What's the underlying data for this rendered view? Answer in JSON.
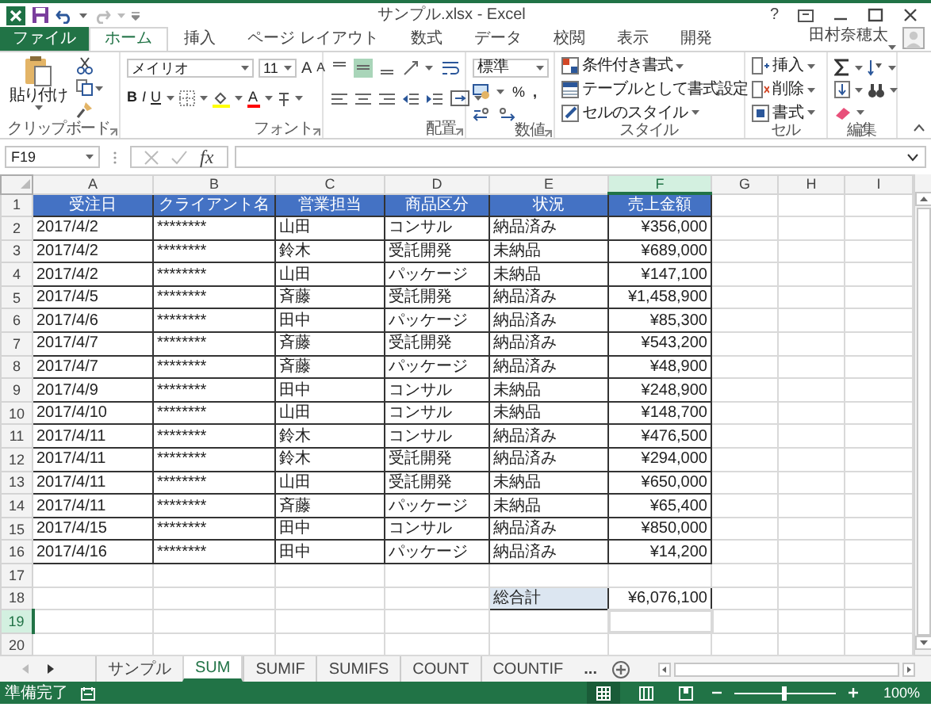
{
  "title_bar": {
    "title": "サンプル.xlsx - Excel",
    "help": "?"
  },
  "ribbon_tabs": [
    {
      "label": "ファイル",
      "kind": "file",
      "selected": false
    },
    {
      "label": "ホーム",
      "kind": "tab",
      "selected": true
    },
    {
      "label": "挿入",
      "kind": "tab",
      "selected": false
    },
    {
      "label": "ページ レイアウト",
      "kind": "tab",
      "selected": false
    },
    {
      "label": "数式",
      "kind": "tab",
      "selected": false
    },
    {
      "label": "データ",
      "kind": "tab",
      "selected": false
    },
    {
      "label": "校閲",
      "kind": "tab",
      "selected": false
    },
    {
      "label": "表示",
      "kind": "tab",
      "selected": false
    },
    {
      "label": "開発",
      "kind": "tab",
      "selected": false
    }
  ],
  "user": "田村奈穂太",
  "ribbon": {
    "clipboard": {
      "paste": "貼り付け",
      "label": "クリップボード"
    },
    "font": {
      "name": "メイリオ",
      "size": "11",
      "grow": "A",
      "shrink": "A",
      "bold": "B",
      "italic": "I",
      "underline": "U",
      "font_color": "A",
      "label": "フォント"
    },
    "alignment": {
      "label": "配置"
    },
    "number": {
      "format": "標準",
      "percent": "%",
      "comma": ",",
      "label": "数値"
    },
    "styles": {
      "items": [
        "条件付き書式",
        "テーブルとして書式設定",
        "セルのスタイル"
      ],
      "label": "スタイル"
    },
    "cells": {
      "items": [
        "挿入",
        "削除",
        "書式"
      ],
      "label": "セル"
    },
    "editing": {
      "label": "編集"
    }
  },
  "formula_bar": {
    "name_box": "F19",
    "fx": "fx"
  },
  "columns": [
    {
      "label": "A",
      "selected": false
    },
    {
      "label": "B",
      "selected": false
    },
    {
      "label": "C",
      "selected": false
    },
    {
      "label": "D",
      "selected": false
    },
    {
      "label": "E",
      "selected": false
    },
    {
      "label": "F",
      "selected": true
    },
    {
      "label": "G",
      "selected": false
    },
    {
      "label": "H",
      "selected": false
    },
    {
      "label": "I",
      "selected": false
    }
  ],
  "rows": [
    {
      "number": "1",
      "kind": "header",
      "selected": false,
      "cells": {
        "A": "受注日",
        "B": "クライアント名",
        "C": "営業担当",
        "D": "商品区分",
        "E": "状況",
        "F": "売上金額"
      }
    },
    {
      "number": "2",
      "kind": "data",
      "selected": false,
      "cells": {
        "A": "2017/4/2",
        "B": "********",
        "C": "山田",
        "D": "コンサル",
        "E": "納品済み",
        "F": "¥356,000"
      }
    },
    {
      "number": "3",
      "kind": "data",
      "selected": false,
      "cells": {
        "A": "2017/4/2",
        "B": "********",
        "C": "鈴木",
        "D": "受託開発",
        "E": "未納品",
        "F": "¥689,000"
      }
    },
    {
      "number": "4",
      "kind": "data",
      "selected": false,
      "cells": {
        "A": "2017/4/2",
        "B": "********",
        "C": "山田",
        "D": "パッケージ",
        "E": "未納品",
        "F": "¥147,100"
      }
    },
    {
      "number": "5",
      "kind": "data",
      "selected": false,
      "cells": {
        "A": "2017/4/5",
        "B": "********",
        "C": "斉藤",
        "D": "受託開発",
        "E": "納品済み",
        "F": "¥1,458,900"
      }
    },
    {
      "number": "6",
      "kind": "data",
      "selected": false,
      "cells": {
        "A": "2017/4/6",
        "B": "********",
        "C": "田中",
        "D": "パッケージ",
        "E": "納品済み",
        "F": "¥85,300"
      }
    },
    {
      "number": "7",
      "kind": "data",
      "selected": false,
      "cells": {
        "A": "2017/4/7",
        "B": "********",
        "C": "斉藤",
        "D": "受託開発",
        "E": "納品済み",
        "F": "¥543,200"
      }
    },
    {
      "number": "8",
      "kind": "data",
      "selected": false,
      "cells": {
        "A": "2017/4/7",
        "B": "********",
        "C": "斉藤",
        "D": "パッケージ",
        "E": "納品済み",
        "F": "¥48,900"
      }
    },
    {
      "number": "9",
      "kind": "data",
      "selected": false,
      "cells": {
        "A": "2017/4/9",
        "B": "********",
        "C": "田中",
        "D": "コンサル",
        "E": "未納品",
        "F": "¥248,900"
      }
    },
    {
      "number": "10",
      "kind": "data",
      "selected": false,
      "cells": {
        "A": "2017/4/10",
        "B": "********",
        "C": "山田",
        "D": "コンサル",
        "E": "未納品",
        "F": "¥148,700"
      }
    },
    {
      "number": "11",
      "kind": "data",
      "selected": false,
      "cells": {
        "A": "2017/4/11",
        "B": "********",
        "C": "鈴木",
        "D": "コンサル",
        "E": "納品済み",
        "F": "¥476,500"
      }
    },
    {
      "number": "12",
      "kind": "data",
      "selected": false,
      "cells": {
        "A": "2017/4/11",
        "B": "********",
        "C": "鈴木",
        "D": "受託開発",
        "E": "納品済み",
        "F": "¥294,000"
      }
    },
    {
      "number": "13",
      "kind": "data",
      "selected": false,
      "cells": {
        "A": "2017/4/11",
        "B": "********",
        "C": "山田",
        "D": "受託開発",
        "E": "未納品",
        "F": "¥650,000"
      }
    },
    {
      "number": "14",
      "kind": "data",
      "selected": false,
      "cells": {
        "A": "2017/4/11",
        "B": "********",
        "C": "斉藤",
        "D": "パッケージ",
        "E": "未納品",
        "F": "¥65,400"
      }
    },
    {
      "number": "15",
      "kind": "data",
      "selected": false,
      "cells": {
        "A": "2017/4/15",
        "B": "********",
        "C": "田中",
        "D": "コンサル",
        "E": "納品済み",
        "F": "¥850,000"
      }
    },
    {
      "number": "16",
      "kind": "data",
      "selected": false,
      "cells": {
        "A": "2017/4/16",
        "B": "********",
        "C": "田中",
        "D": "パッケージ",
        "E": "納品済み",
        "F": "¥14,200"
      }
    },
    {
      "number": "17",
      "kind": "blank",
      "selected": false
    },
    {
      "number": "18",
      "kind": "total",
      "selected": false,
      "cells": {
        "E": "総合計",
        "F": "¥6,076,100"
      }
    },
    {
      "number": "19",
      "kind": "blank",
      "selected": true
    },
    {
      "number": "20",
      "kind": "blank",
      "selected": false
    }
  ],
  "sheet_tabs": [
    {
      "label": "サンプル",
      "selected": false
    },
    {
      "label": "SUM",
      "selected": true
    },
    {
      "label": "SUMIF",
      "selected": false
    },
    {
      "label": "SUMIFS",
      "selected": false
    },
    {
      "label": "COUNT",
      "selected": false
    },
    {
      "label": "COUNTIF",
      "selected": false
    }
  ],
  "more_sheets": "...",
  "status_bar": {
    "status": "準備完了",
    "zoom": {
      "level": 0.5,
      "reading": "100%"
    }
  }
}
